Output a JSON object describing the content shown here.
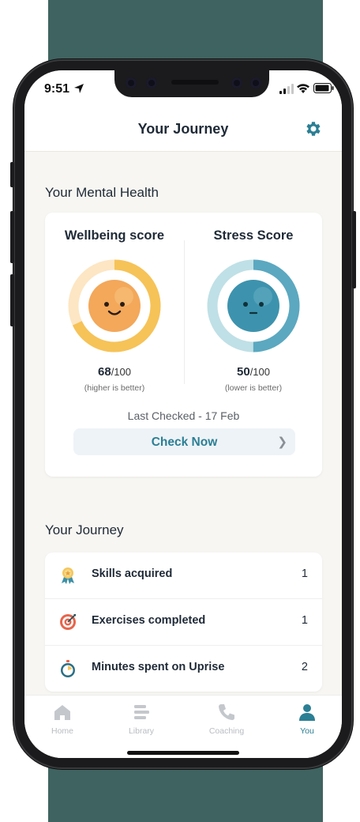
{
  "status_bar": {
    "time": "9:51"
  },
  "header": {
    "title": "Your Journey"
  },
  "mental_health": {
    "section_title": "Your Mental Health",
    "wellbeing": {
      "title": "Wellbeing score",
      "value": "68",
      "denominator": "/100",
      "hint": "(higher is better)",
      "fraction": 0.68,
      "color": "#f6c358"
    },
    "stress": {
      "title": "Stress Score",
      "value": "50",
      "denominator": "/100",
      "hint": "(lower is better)",
      "fraction": 0.5,
      "color": "#5ba8c0"
    },
    "last_checked": "Last Checked - 17 Feb",
    "check_button": "Check Now"
  },
  "journey": {
    "section_title": "Your Journey",
    "items": [
      {
        "label": "Skills acquired",
        "count": "1",
        "icon": "award-ribbon-icon"
      },
      {
        "label": "Exercises completed",
        "count": "1",
        "icon": "target-icon"
      },
      {
        "label": "Minutes spent on Uprise",
        "count": "2",
        "icon": "stopwatch-icon"
      }
    ]
  },
  "tabs": [
    {
      "label": "Home",
      "icon": "home-icon",
      "active": false
    },
    {
      "label": "Library",
      "icon": "library-icon",
      "active": false
    },
    {
      "label": "Coaching",
      "icon": "phone-icon",
      "active": false
    },
    {
      "label": "You",
      "icon": "person-icon",
      "active": true
    }
  ],
  "colors": {
    "accent": "#2b7f94",
    "backdrop": "#3f6360"
  }
}
